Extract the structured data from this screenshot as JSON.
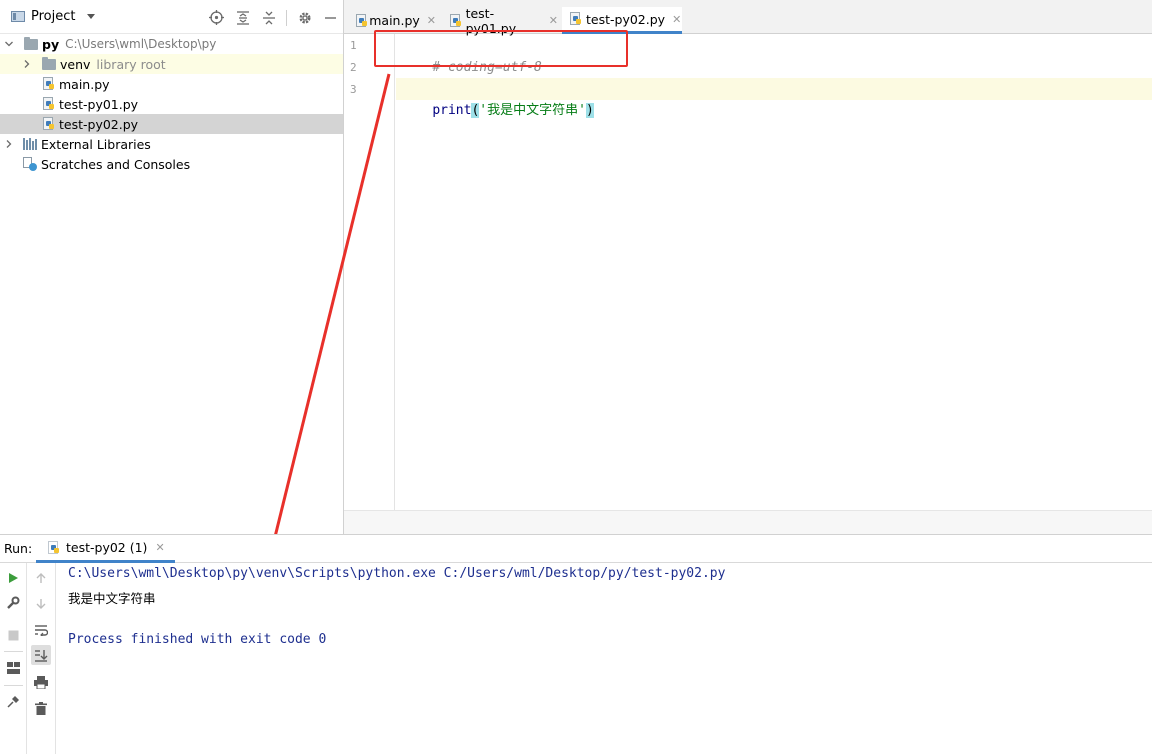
{
  "project": {
    "title": "Project",
    "tree": [
      {
        "label": "py",
        "path": "C:\\Users\\wml\\Desktop\\py"
      },
      {
        "label": "venv",
        "tag": "library root"
      },
      {
        "label": "main.py"
      },
      {
        "label": "test-py01.py"
      },
      {
        "label": "test-py02.py"
      },
      {
        "label": "External Libraries"
      },
      {
        "label": "Scratches and Consoles"
      }
    ]
  },
  "editor": {
    "tabs": [
      {
        "label": "main.py"
      },
      {
        "label": "test-py01.py"
      },
      {
        "label": "test-py02.py",
        "active": true
      }
    ],
    "line_numbers": [
      "1",
      "2",
      "3"
    ],
    "code": {
      "line1": "# coding=utf-8",
      "line3_fn": "print",
      "line3_open": "(",
      "line3_str": "'我是中文字符串'",
      "line3_close": ")"
    }
  },
  "run": {
    "label": "Run:",
    "tab": "test-py02 (1)",
    "console": {
      "command": "C:\\Users\\wml\\Desktop\\py\\venv\\Scripts\\python.exe C:/Users/wml/Desktop/py/test-py02.py",
      "output": "我是中文字符串",
      "finish": "Process finished with exit code 0"
    }
  },
  "colors": {
    "annotation": "#e8302a",
    "tab_underline": "#4083c9",
    "selection": "#d4d4d4"
  }
}
